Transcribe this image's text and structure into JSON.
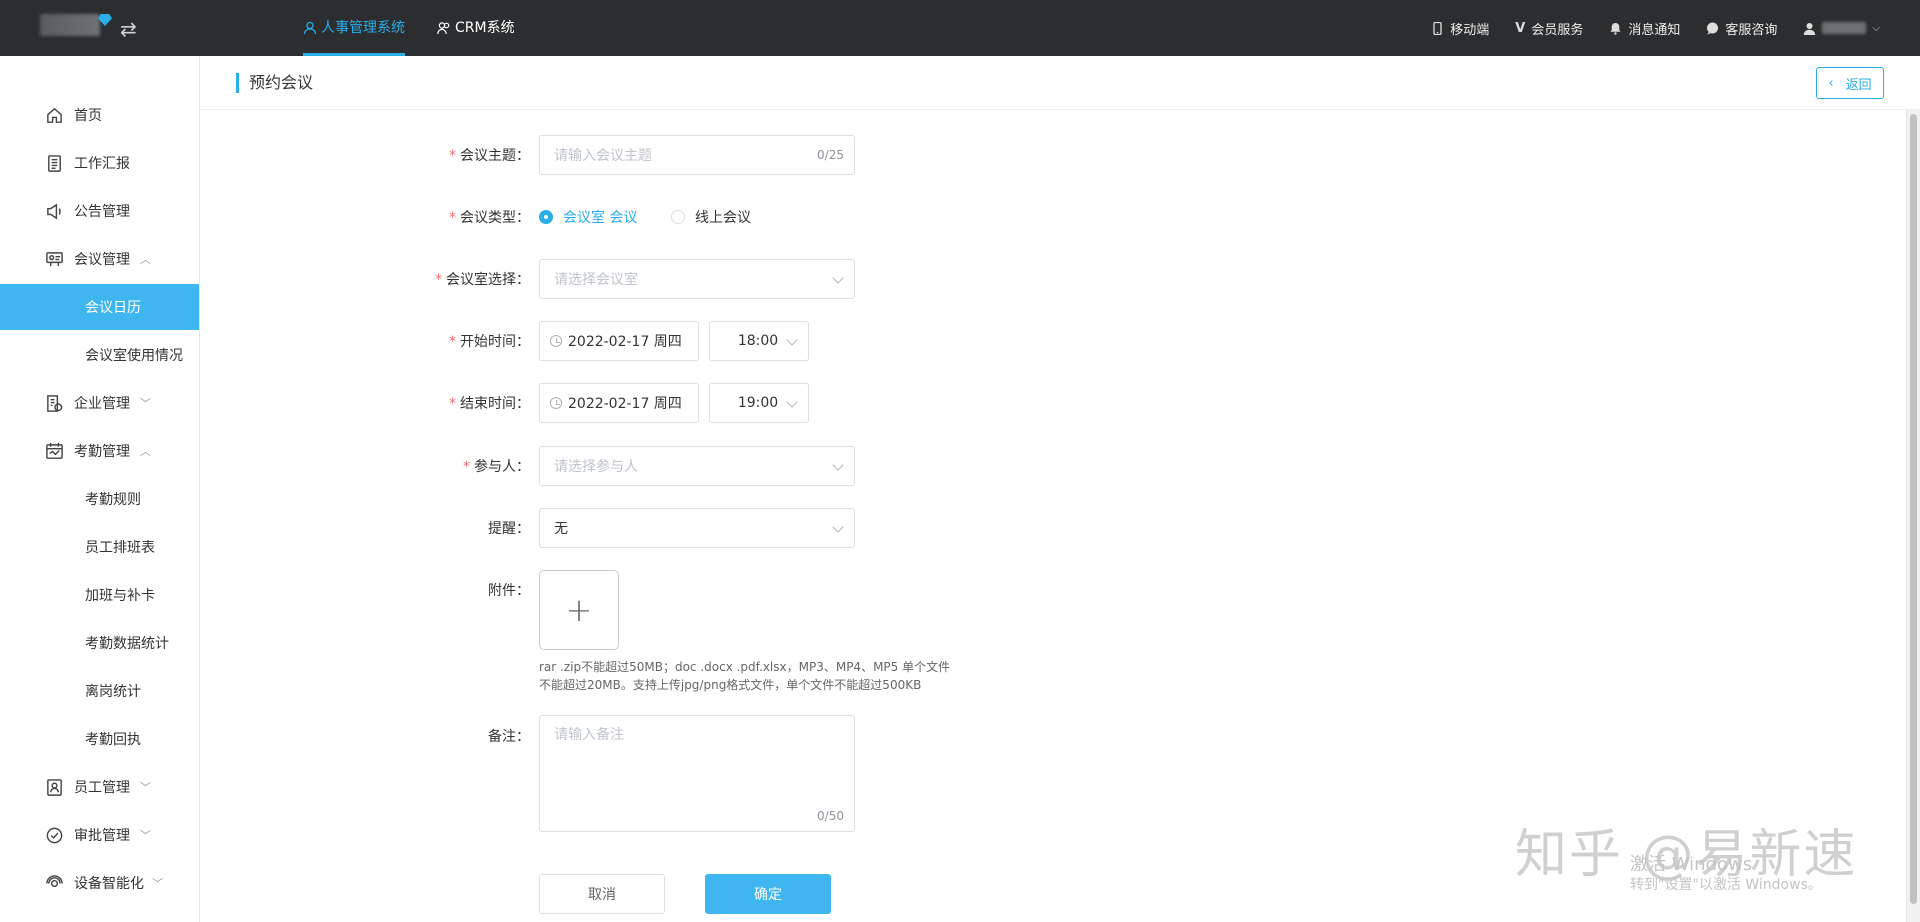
{
  "topbar": {
    "tabs": [
      {
        "label": "人事管理系统",
        "active": true
      },
      {
        "label": "CRM系统",
        "active": false
      }
    ],
    "right_items": [
      {
        "label": "移动端",
        "icon": "mobile-icon"
      },
      {
        "label": "会员服务",
        "icon": "vip-icon"
      },
      {
        "label": "消息通知",
        "icon": "bell-icon"
      },
      {
        "label": "客服咨询",
        "icon": "chat-icon"
      }
    ]
  },
  "sidebar": {
    "items": [
      {
        "label": "首页",
        "icon": "home-icon"
      },
      {
        "label": "工作汇报",
        "icon": "report-icon"
      },
      {
        "label": "公告管理",
        "icon": "megaphone-icon"
      },
      {
        "label": "会议管理",
        "icon": "meeting-icon",
        "expanded": true
      },
      {
        "label": "会议日历",
        "sub": true,
        "active": true
      },
      {
        "label": "会议室使用情况",
        "sub": true
      },
      {
        "label": "企业管理",
        "icon": "enterprise-icon",
        "expanded": false
      },
      {
        "label": "考勤管理",
        "icon": "attendance-icon",
        "expanded": true
      },
      {
        "label": "考勤规则",
        "sub": true
      },
      {
        "label": "员工排班表",
        "sub": true
      },
      {
        "label": "加班与补卡",
        "sub": true
      },
      {
        "label": "考勤数据统计",
        "sub": true
      },
      {
        "label": "离岗统计",
        "sub": true
      },
      {
        "label": "考勤回执",
        "sub": true
      },
      {
        "label": "员工管理",
        "icon": "employee-icon",
        "expanded": false
      },
      {
        "label": "审批管理",
        "icon": "approval-icon",
        "expanded": false
      },
      {
        "label": "设备智能化",
        "icon": "device-icon",
        "expanded": false
      }
    ]
  },
  "header": {
    "title": "预约会议",
    "back_label": "返回"
  },
  "form": {
    "topic": {
      "label": "会议主题：",
      "placeholder": "请输入会议主题",
      "counter": "0/25"
    },
    "type": {
      "label": "会议类型：",
      "options": [
        "会议室 会议",
        "线上会议"
      ],
      "selected": "会议室 会议"
    },
    "room": {
      "label": "会议室选择：",
      "placeholder": "请选择会议室"
    },
    "start": {
      "label": "开始时间：",
      "date": "2022-02-17 周四",
      "time": "18:00"
    },
    "end": {
      "label": "结束时间：",
      "date": "2022-02-17 周四",
      "time": "19:00"
    },
    "participants": {
      "label": "参与人：",
      "placeholder": "请选择参与人"
    },
    "reminder": {
      "label": "提醒：",
      "value": "无"
    },
    "attachment": {
      "label": "附件：",
      "hint_line1": "rar .zip不能超过50MB；doc .docx .pdf.xlsx，MP3、MP4、MP5 单个文件",
      "hint_line2": "不能超过20MB。支持上传jpg/png格式文件，单个文件不能超过500KB"
    },
    "remark": {
      "label": "备注：",
      "placeholder": "请输入备注",
      "counter": "0/50"
    },
    "cancel_label": "取消",
    "confirm_label": "确定"
  },
  "watermark": {
    "activate_line1": "激活 Windows",
    "activate_line2": "转到\"设置\"以激活 Windows。",
    "zhihu": "知乎 @易新速"
  },
  "colors": {
    "accent": "#29aee8",
    "topbar_bg": "#2b2d2f",
    "active_menu_bg": "#3fb6ef",
    "required": "#f56c6c"
  }
}
